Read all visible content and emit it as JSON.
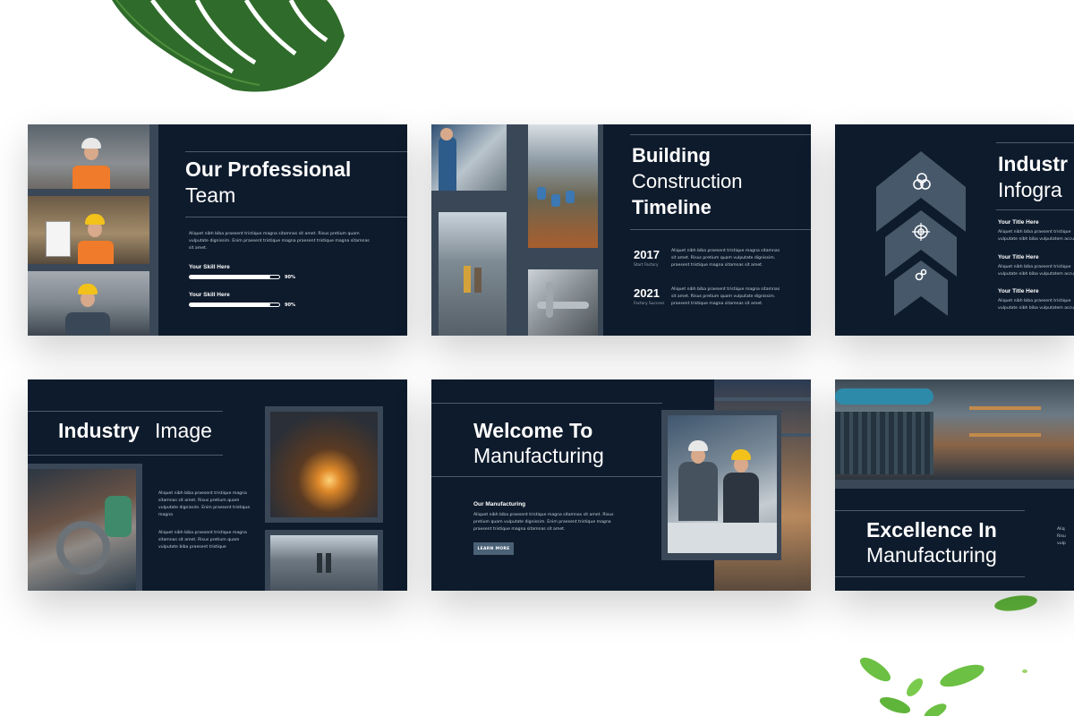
{
  "slides": {
    "team": {
      "title_bold": "Our Professional",
      "title_light": "Team",
      "body": "Aliquet nibh biba praesent tristique magna sitamnas sit amet. Risus pretium quam vulputate dignissim. Enim praesent tristique magna praesent tristique magna sitamnas sit amet.",
      "skills": [
        {
          "label": "Your Skill Here",
          "percent": 90,
          "percent_text": "90%"
        },
        {
          "label": "Your Skill Here",
          "percent": 90,
          "percent_text": "90%"
        }
      ]
    },
    "timeline": {
      "title_line1": "Building",
      "title_line2": "Construction",
      "title_line3": "Timeline",
      "events": [
        {
          "year": "2017",
          "sub": "Start Factory",
          "text": "Aliquet nibh biba praesent tristique magna sitamnas sit amet. Risus pretium quam vulputate dignissim. praesent tristique magna sitamnas sit amet."
        },
        {
          "year": "2021",
          "sub": "Factory Success",
          "text": "Aliquet nibh biba praesent tristique magna sitamnas sit amet. Risus pretium quam vulputate dignissim. praesent tristique magna sitamnas sit amet."
        }
      ]
    },
    "infographic": {
      "title_bold": "Industr",
      "title_light": "Infogra",
      "items": [
        {
          "title": "Your Title Here",
          "text": "Aliquet nibh biba praesent tristique vulputate nibh biba vulputatem accu"
        },
        {
          "title": "Your Title Here",
          "text": "Aliquet nibh biba praesent tristique vulputate nibh biba vulputatem accu"
        },
        {
          "title": "Your Title Here",
          "text": "Aliquet nibh biba praesent tristique vulputate nibh biba vulputatem accu"
        }
      ],
      "icons": [
        "circles-icon",
        "target-icon",
        "gears-icon"
      ]
    },
    "industry_image": {
      "title_bold": "Industry",
      "title_light": "Image",
      "para1": "Aliquet nibh biba praesent tristique magna sitamnas sit amet. Risus pretium quam vulputate dignissim. Enim praesent tristique magna",
      "para2": "Aliquet nibh biba praesent tristique magna sitamnas sit amet. Risus pretium quam vulputate biba praesent tristique"
    },
    "welcome": {
      "title_bold": "Welcome To",
      "title_light": "Manufacturing",
      "subheading": "Our Manufacturing",
      "body": "Aliquet nibh biba praesent tristique magna sitamnas sit amet. Risus pretium quam vulputate dignissim. Enim praesent tristique magna praesent tristique magna sitamnas sit amet.",
      "button": "LEARN MORE"
    },
    "excellence": {
      "title_bold": "Excellence In",
      "title_light": "Manufacturing",
      "side_text": "Aliq Risu vulp"
    }
  },
  "colors": {
    "slide_bg": "#0e1b2c",
    "frame": "#3a4757",
    "button": "#4b6276",
    "text": "#ffffff"
  }
}
